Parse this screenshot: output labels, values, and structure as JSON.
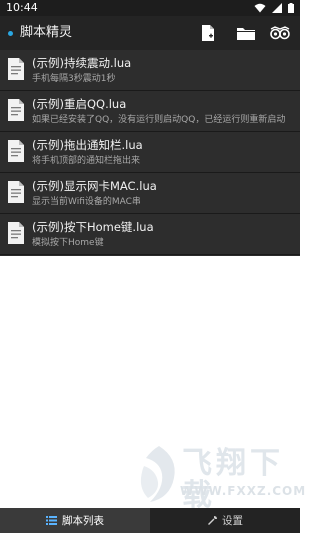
{
  "status_bar": {
    "time": "10:44",
    "icons": [
      "wifi-icon",
      "signal-icon",
      "battery-icon"
    ]
  },
  "app_bar": {
    "title": "脚本精灵",
    "accent": "#2aa7e2",
    "actions": [
      "new-file-icon",
      "folder-icon",
      "owl-icon"
    ]
  },
  "scripts": [
    {
      "title": "(示例)持续震动.lua",
      "desc": "手机每隔3秒震动1秒"
    },
    {
      "title": "(示例)重启QQ.lua",
      "desc": "如果已经安装了QQ，没有运行则启动QQ，已经运行则重新启动"
    },
    {
      "title": "(示例)拖出通知栏.lua",
      "desc": "将手机顶部的通知栏拖出来"
    },
    {
      "title": "(示例)显示网卡MAC.lua",
      "desc": "显示当前Wifi设备的MAC串"
    },
    {
      "title": "(示例)按下Home键.lua",
      "desc": "模拟按下Home键"
    }
  ],
  "bottom_tabs": [
    {
      "label": "脚本列表",
      "icon": "list-icon"
    },
    {
      "label": "设置",
      "icon": "wrench-icon"
    }
  ],
  "watermark": {
    "text": "飞翔下载",
    "url_text": "WWW.FXXZ.COM"
  }
}
